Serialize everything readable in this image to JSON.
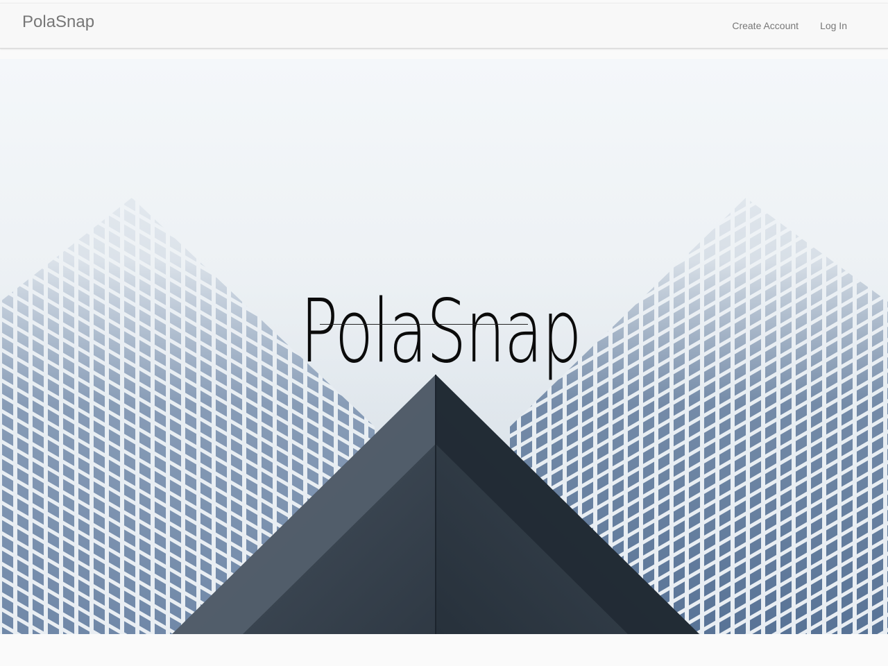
{
  "navbar": {
    "brand": "PolaSnap",
    "links": [
      {
        "label": "Create Account"
      },
      {
        "label": "Log In"
      }
    ]
  },
  "hero": {
    "title": "PolaSnap",
    "background": "skyscrapers-photo"
  },
  "colors": {
    "navbar_bg": "#f8f8f8",
    "nav_text": "#777777",
    "hero_title": "#0b0b0b",
    "building_glass": "#6f87a6",
    "building_concrete": "#3b4652"
  }
}
